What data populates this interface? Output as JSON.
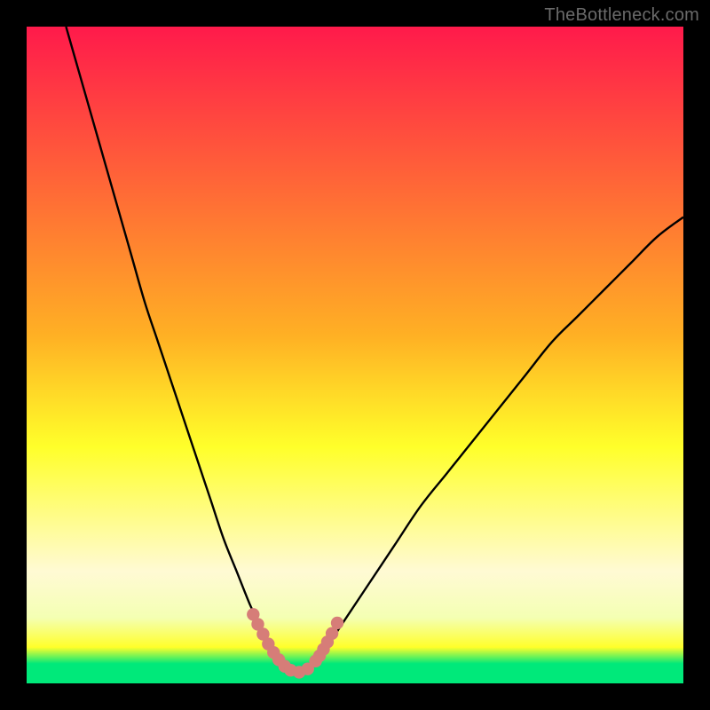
{
  "watermark_text": "TheBottleneck.com",
  "colors": {
    "bg": "#000000",
    "grad_top": "#ff1a4b",
    "grad_mid1": "#ffb024",
    "grad_mid2": "#ffff2a",
    "grad_cream": "#fffad4",
    "grad_cream2": "#f4ffb3",
    "grad_bottom": "#00e97a",
    "curve": "#000000",
    "marker": "#d67d78"
  },
  "chart_data": {
    "type": "line",
    "title": "",
    "xlabel": "",
    "ylabel": "",
    "xlim": [
      0,
      100
    ],
    "ylim": [
      0,
      100
    ],
    "series": [
      {
        "name": "bottleneck_curve",
        "x": [
          6,
          8,
          10,
          12,
          14,
          16,
          18,
          20,
          22,
          24,
          26,
          28,
          30,
          32,
          34,
          35,
          36,
          37,
          38,
          39,
          40,
          41,
          42,
          43,
          44,
          46,
          48,
          52,
          56,
          60,
          64,
          68,
          72,
          76,
          80,
          84,
          88,
          92,
          96,
          100
        ],
        "y": [
          100,
          93,
          86,
          79,
          72,
          65,
          58,
          52,
          46,
          40,
          34,
          28,
          22,
          17,
          12,
          10,
          8,
          6,
          4.5,
          3,
          2,
          1.5,
          1.5,
          2.2,
          3.5,
          6,
          9,
          15,
          21,
          27,
          32,
          37,
          42,
          47,
          52,
          56,
          60,
          64,
          68,
          71
        ]
      }
    ],
    "markers": {
      "name": "highlight_points",
      "x": [
        34.5,
        35.2,
        36.0,
        36.8,
        37.6,
        38.4,
        39.3,
        40.2,
        41.5,
        42.8,
        44.0,
        44.6,
        45.2,
        45.8,
        46.5,
        47.3
      ],
      "y": [
        10.5,
        9.0,
        7.5,
        6.0,
        4.7,
        3.6,
        2.6,
        2.0,
        1.7,
        2.2,
        3.4,
        4.2,
        5.2,
        6.3,
        7.6,
        9.2
      ]
    },
    "gradient_stops": [
      {
        "pos": 0.0,
        "color_key": "grad_top"
      },
      {
        "pos": 0.47,
        "color_key": "grad_mid1"
      },
      {
        "pos": 0.64,
        "color_key": "grad_mid2"
      },
      {
        "pos": 0.83,
        "color_key": "grad_cream"
      },
      {
        "pos": 0.9,
        "color_key": "grad_cream2"
      },
      {
        "pos": 0.945,
        "color_key": "grad_mid2"
      },
      {
        "pos": 0.97,
        "color_key": "grad_bottom"
      },
      {
        "pos": 1.0,
        "color_key": "grad_bottom"
      }
    ]
  }
}
